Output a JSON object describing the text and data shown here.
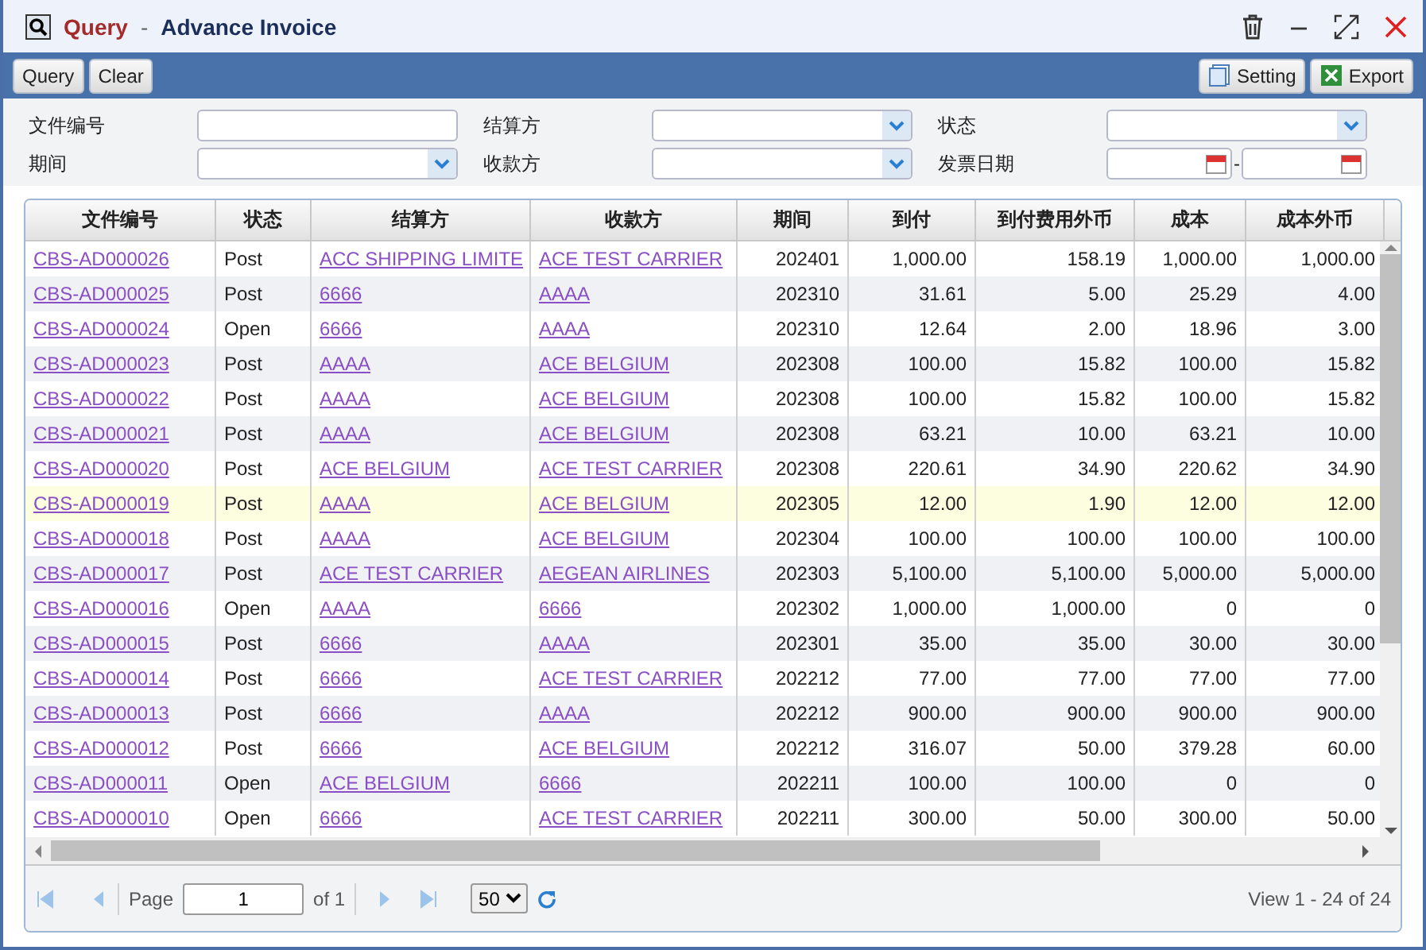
{
  "window": {
    "title_module": "Query",
    "title_separator": "-",
    "title_page": "Advance Invoice"
  },
  "toolbar": {
    "left": [
      {
        "label": "Query"
      },
      {
        "label": "Clear"
      }
    ],
    "right": [
      {
        "label": "Setting",
        "kind": "setting"
      },
      {
        "label": "Export",
        "kind": "export"
      }
    ]
  },
  "filters": [
    {
      "label": "文件编号",
      "kind": "text"
    },
    {
      "label": "结算方",
      "kind": "select"
    },
    {
      "label": "状态",
      "kind": "select"
    },
    {
      "label": "期间",
      "kind": "select"
    },
    {
      "label": "收款方",
      "kind": "select"
    },
    {
      "label": "发票日期",
      "kind": "daterange",
      "separator": "-"
    }
  ],
  "table": {
    "columns": [
      {
        "label": "文件编号",
        "kind": "link"
      },
      {
        "label": "状态",
        "kind": "text"
      },
      {
        "label": "结算方",
        "kind": "link"
      },
      {
        "label": "收款方",
        "kind": "link"
      },
      {
        "label": "期间",
        "kind": "number"
      },
      {
        "label": "到付",
        "kind": "number"
      },
      {
        "label": "到付费用外币",
        "kind": "number"
      },
      {
        "label": "成本",
        "kind": "number"
      },
      {
        "label": "成本外币",
        "kind": "number"
      }
    ],
    "rows": [
      {
        "selected": false,
        "cells": [
          "CBS-AD000026",
          "Post",
          "ACC SHIPPING LIMITE",
          "ACE TEST CARRIER",
          "202401",
          "1,000.00",
          "158.19",
          "1,000.00",
          "1,000.00"
        ]
      },
      {
        "selected": false,
        "cells": [
          "CBS-AD000025",
          "Post",
          "6666",
          "AAAA",
          "202310",
          "31.61",
          "5.00",
          "25.29",
          "4.00"
        ]
      },
      {
        "selected": false,
        "cells": [
          "CBS-AD000024",
          "Open",
          "6666",
          "AAAA",
          "202310",
          "12.64",
          "2.00",
          "18.96",
          "3.00"
        ]
      },
      {
        "selected": false,
        "cells": [
          "CBS-AD000023",
          "Post",
          "AAAA",
          "ACE BELGIUM",
          "202308",
          "100.00",
          "15.82",
          "100.00",
          "15.82"
        ]
      },
      {
        "selected": false,
        "cells": [
          "CBS-AD000022",
          "Post",
          "AAAA",
          "ACE BELGIUM",
          "202308",
          "100.00",
          "15.82",
          "100.00",
          "15.82"
        ]
      },
      {
        "selected": false,
        "cells": [
          "CBS-AD000021",
          "Post",
          "AAAA",
          "ACE BELGIUM",
          "202308",
          "63.21",
          "10.00",
          "63.21",
          "10.00"
        ]
      },
      {
        "selected": false,
        "cells": [
          "CBS-AD000020",
          "Post",
          "ACE BELGIUM",
          "ACE TEST CARRIER",
          "202308",
          "220.61",
          "34.90",
          "220.62",
          "34.90"
        ]
      },
      {
        "selected": true,
        "cells": [
          "CBS-AD000019",
          "Post",
          "AAAA",
          "ACE BELGIUM",
          "202305",
          "12.00",
          "1.90",
          "12.00",
          "12.00"
        ]
      },
      {
        "selected": false,
        "cells": [
          "CBS-AD000018",
          "Post",
          "AAAA",
          "ACE BELGIUM",
          "202304",
          "100.00",
          "100.00",
          "100.00",
          "100.00"
        ]
      },
      {
        "selected": false,
        "cells": [
          "CBS-AD000017",
          "Post",
          "ACE TEST CARRIER",
          "AEGEAN AIRLINES",
          "202303",
          "5,100.00",
          "5,100.00",
          "5,000.00",
          "5,000.00"
        ]
      },
      {
        "selected": false,
        "cells": [
          "CBS-AD000016",
          "Open",
          "AAAA",
          "6666",
          "202302",
          "1,000.00",
          "1,000.00",
          "0",
          "0"
        ]
      },
      {
        "selected": false,
        "cells": [
          "CBS-AD000015",
          "Post",
          "6666",
          "AAAA",
          "202301",
          "35.00",
          "35.00",
          "30.00",
          "30.00"
        ]
      },
      {
        "selected": false,
        "cells": [
          "CBS-AD000014",
          "Post",
          "6666",
          "ACE TEST CARRIER",
          "202212",
          "77.00",
          "77.00",
          "77.00",
          "77.00"
        ]
      },
      {
        "selected": false,
        "cells": [
          "CBS-AD000013",
          "Post",
          "6666",
          "AAAA",
          "202212",
          "900.00",
          "900.00",
          "900.00",
          "900.00"
        ]
      },
      {
        "selected": false,
        "cells": [
          "CBS-AD000012",
          "Post",
          "6666",
          "ACE BELGIUM",
          "202212",
          "316.07",
          "50.00",
          "379.28",
          "60.00"
        ]
      },
      {
        "selected": false,
        "cells": [
          "CBS-AD000011",
          "Open",
          "ACE BELGIUM",
          "6666",
          "202211",
          "100.00",
          "100.00",
          "0",
          "0"
        ]
      },
      {
        "selected": false,
        "cells": [
          "CBS-AD000010",
          "Open",
          "6666",
          "ACE TEST CARRIER",
          "202211",
          "300.00",
          "50.00",
          "300.00",
          "50.00"
        ]
      }
    ]
  },
  "pager": {
    "page_label": "Page",
    "page": "1",
    "of_label": "of 1",
    "page_size": "50",
    "summary": "View 1 - 24 of 24"
  }
}
